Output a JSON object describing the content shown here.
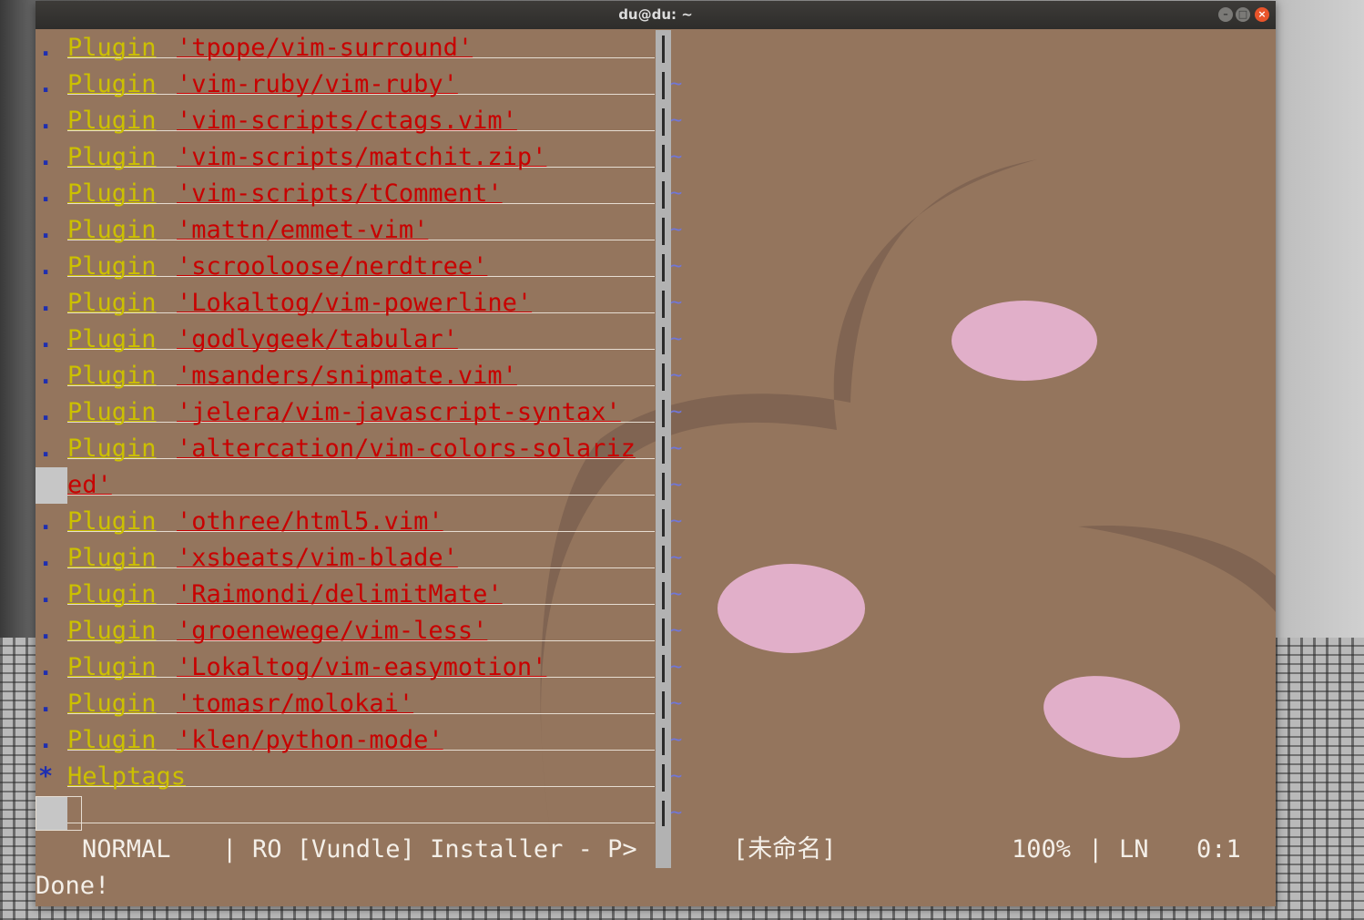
{
  "window": {
    "title": "du@du: ~",
    "buttons": {
      "minimize": "–",
      "maximize": "□",
      "close": "×"
    }
  },
  "colors": {
    "terminal_bg": "#94755d",
    "keyword": "#ccc000",
    "string": "#c80000",
    "marker": "#1f2fb0",
    "tilde": "#7076d8",
    "statusline_fg": "#f4efe8"
  },
  "editor": {
    "lines": [
      {
        "marker": ".",
        "keyword": "Plugin",
        "value": "'tpope/vim-surround'"
      },
      {
        "marker": ".",
        "keyword": "Plugin",
        "value": "'vim-ruby/vim-ruby'"
      },
      {
        "marker": ".",
        "keyword": "Plugin",
        "value": "'vim-scripts/ctags.vim'"
      },
      {
        "marker": ".",
        "keyword": "Plugin",
        "value": "'vim-scripts/matchit.zip'"
      },
      {
        "marker": ".",
        "keyword": "Plugin",
        "value": "'vim-scripts/tComment'"
      },
      {
        "marker": ".",
        "keyword": "Plugin",
        "value": "'mattn/emmet-vim'"
      },
      {
        "marker": ".",
        "keyword": "Plugin",
        "value": "'scrooloose/nerdtree'"
      },
      {
        "marker": ".",
        "keyword": "Plugin",
        "value": "'Lokaltog/vim-powerline'"
      },
      {
        "marker": ".",
        "keyword": "Plugin",
        "value": "'godlygeek/tabular'"
      },
      {
        "marker": ".",
        "keyword": "Plugin",
        "value": "'msanders/snipmate.vim'"
      },
      {
        "marker": ".",
        "keyword": "Plugin",
        "value": "'jelera/vim-javascript-syntax'"
      },
      {
        "marker": ".",
        "keyword": "Plugin",
        "value": "'altercation/vim-colors-solariz"
      },
      {
        "marker": "",
        "keyword": "",
        "value": "ed'",
        "wrapped": true
      },
      {
        "marker": ".",
        "keyword": "Plugin",
        "value": "'othree/html5.vim'"
      },
      {
        "marker": ".",
        "keyword": "Plugin",
        "value": "'xsbeats/vim-blade'"
      },
      {
        "marker": ".",
        "keyword": "Plugin",
        "value": "'Raimondi/delimitMate'"
      },
      {
        "marker": ".",
        "keyword": "Plugin",
        "value": "'groenewege/vim-less'"
      },
      {
        "marker": ".",
        "keyword": "Plugin",
        "value": "'Lokaltog/vim-easymotion'"
      },
      {
        "marker": ".",
        "keyword": "Plugin",
        "value": "'tomasr/molokai'"
      },
      {
        "marker": ".",
        "keyword": "Plugin",
        "value": "'klen/python-mode'"
      },
      {
        "marker": "*",
        "keyword": "Helptags",
        "value": ""
      }
    ],
    "tilde": "~"
  },
  "statusline": {
    "mode": "NORMAL",
    "sep1": "|",
    "left_info": "RO [Vundle] Installer - P>",
    "right_file": "[未命名]",
    "percent": "100%",
    "sep2": "|",
    "ln": "LN",
    "position": "0:1"
  },
  "cmdline": "Done!"
}
